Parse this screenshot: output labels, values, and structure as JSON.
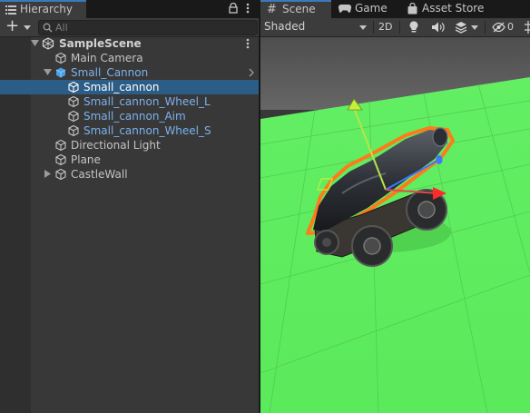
{
  "hierarchy": {
    "tab_label": "Hierarchy",
    "search_placeholder": "All",
    "add_label": "+",
    "scene": {
      "label": "SampleScene"
    },
    "items": [
      {
        "label": "Main Camera"
      },
      {
        "label": "Small_Cannon"
      },
      {
        "label": "Small_cannon"
      },
      {
        "label": "Small_cannon_Wheel_L"
      },
      {
        "label": "Small_cannon_Aim"
      },
      {
        "label": "Small_cannon_Wheel_S"
      },
      {
        "label": "Directional Light"
      },
      {
        "label": "Plane"
      },
      {
        "label": "CastleWall"
      }
    ]
  },
  "scene_view": {
    "tabs": [
      {
        "label": "Scene"
      },
      {
        "label": "Game"
      },
      {
        "label": "Asset Store"
      }
    ],
    "shading_mode": "Shaded",
    "mode_2d_label": "2D",
    "hidden_count": "0"
  },
  "colors": {
    "selection": "#2c5d87",
    "prefab_text": "#7bb2ee",
    "ground": "#5ff05f",
    "sky": "#5a5a5a",
    "outline": "#ff7a1a"
  }
}
